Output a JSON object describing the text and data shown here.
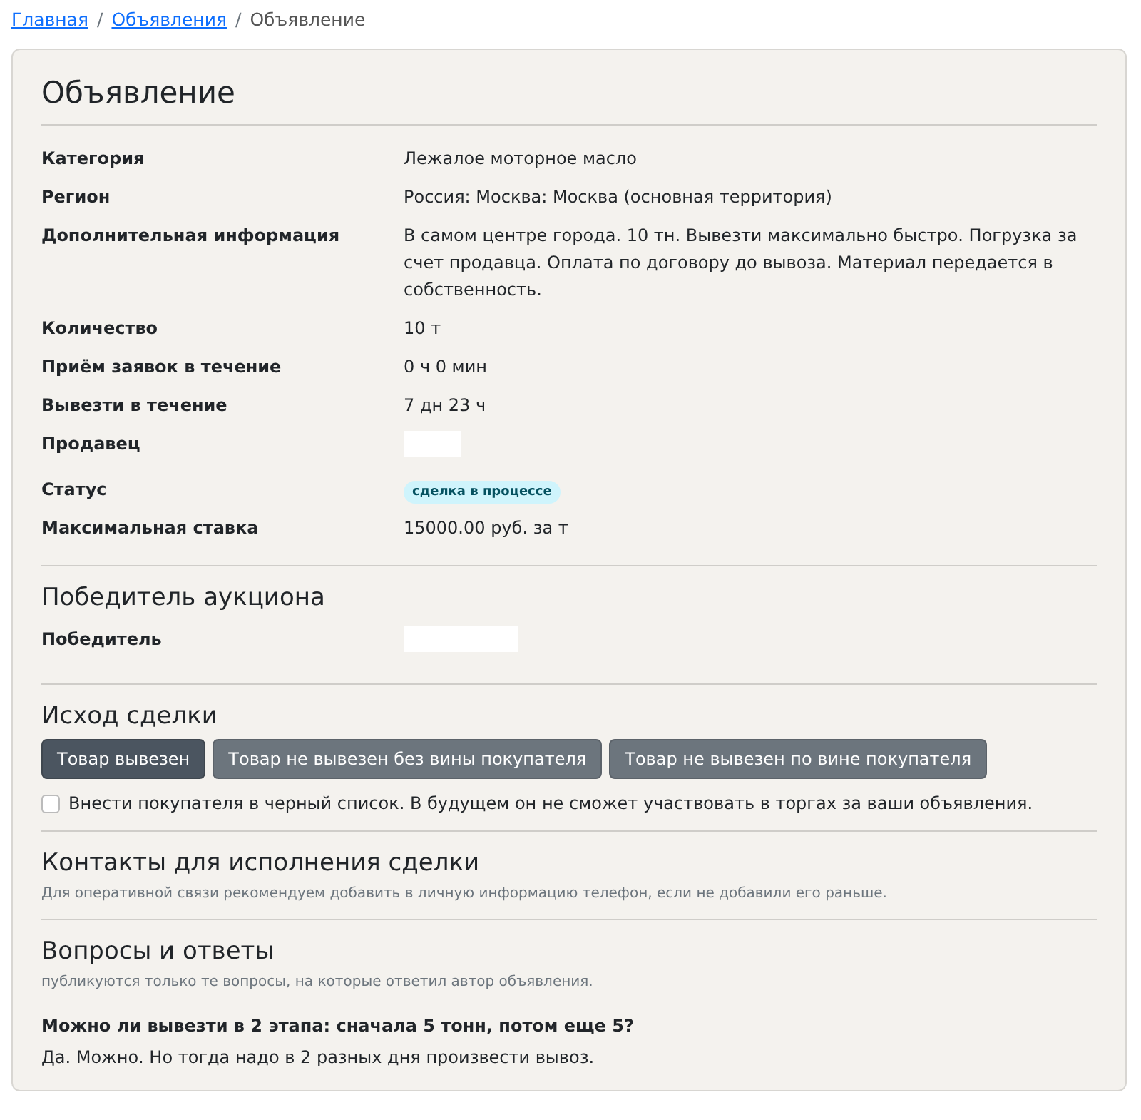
{
  "breadcrumb_separator": "/",
  "breadcrumbs": [
    {
      "label": "Главная",
      "kind": "link"
    },
    {
      "label": "Объявления",
      "kind": "link"
    },
    {
      "label": "Объявление",
      "kind": "current"
    }
  ],
  "listing": {
    "title": "Объявление",
    "fields": [
      {
        "label": "Категория",
        "kind": "text",
        "value": "Лежалое моторное масло"
      },
      {
        "label": "Регион",
        "kind": "text",
        "value": "Россия: Москва: Москва (основная территория)"
      },
      {
        "label": "Дополнительная информация",
        "kind": "text",
        "value": "В самом центре города. 10 тн. Вывезти максимально быстро. Погрузка за счет продавца. Оплата по договору до вывоза. Материал передается в собственность."
      },
      {
        "label": "Количество",
        "kind": "text",
        "value": "10 т"
      },
      {
        "label": "Приём заявок в течение",
        "kind": "text",
        "value": "0 ч 0 мин"
      },
      {
        "label": "Вывезти в течение",
        "kind": "text",
        "value": "7 дн 23 ч"
      },
      {
        "label": "Продавец",
        "kind": "hidden"
      },
      {
        "label": "Статус",
        "kind": "badge",
        "value": "сделка в процессе"
      },
      {
        "label": "Максимальная ставка",
        "kind": "text",
        "value": "15000.00 руб. за т"
      }
    ]
  },
  "winner": {
    "title": "Победитель аукциона",
    "fields": [
      {
        "label": "Победитель",
        "kind": "hidden_wide"
      }
    ]
  },
  "outcome": {
    "title": "Исход сделки",
    "buttons": [
      {
        "label": "Товар вывезен",
        "selected": true
      },
      {
        "label": "Товар не вывезен без вины покупателя",
        "selected": false
      },
      {
        "label": "Товар не вывезен по вине покупателя",
        "selected": false
      }
    ],
    "blacklist": {
      "label": "Внести покупателя в черный список. В будущем он не сможет участвовать в торгах за ваши объявления.",
      "checked": false
    }
  },
  "contacts": {
    "title": "Контакты для исполнения сделки",
    "note": "Для оперативной связи рекомендуем добавить в личную информацию телефон, если не добавили его раньше."
  },
  "qa": {
    "title": "Вопросы и ответы",
    "note": "публикуются только те вопросы, на которые ответил автор объявления.",
    "items": [
      {
        "question": "Можно ли вывезти в 2 этапа: сначала 5 тонн, потом еще 5?",
        "answer": "Да. Можно. Но тогда надо в 2 разных дня произвести вывоз."
      }
    ]
  }
}
